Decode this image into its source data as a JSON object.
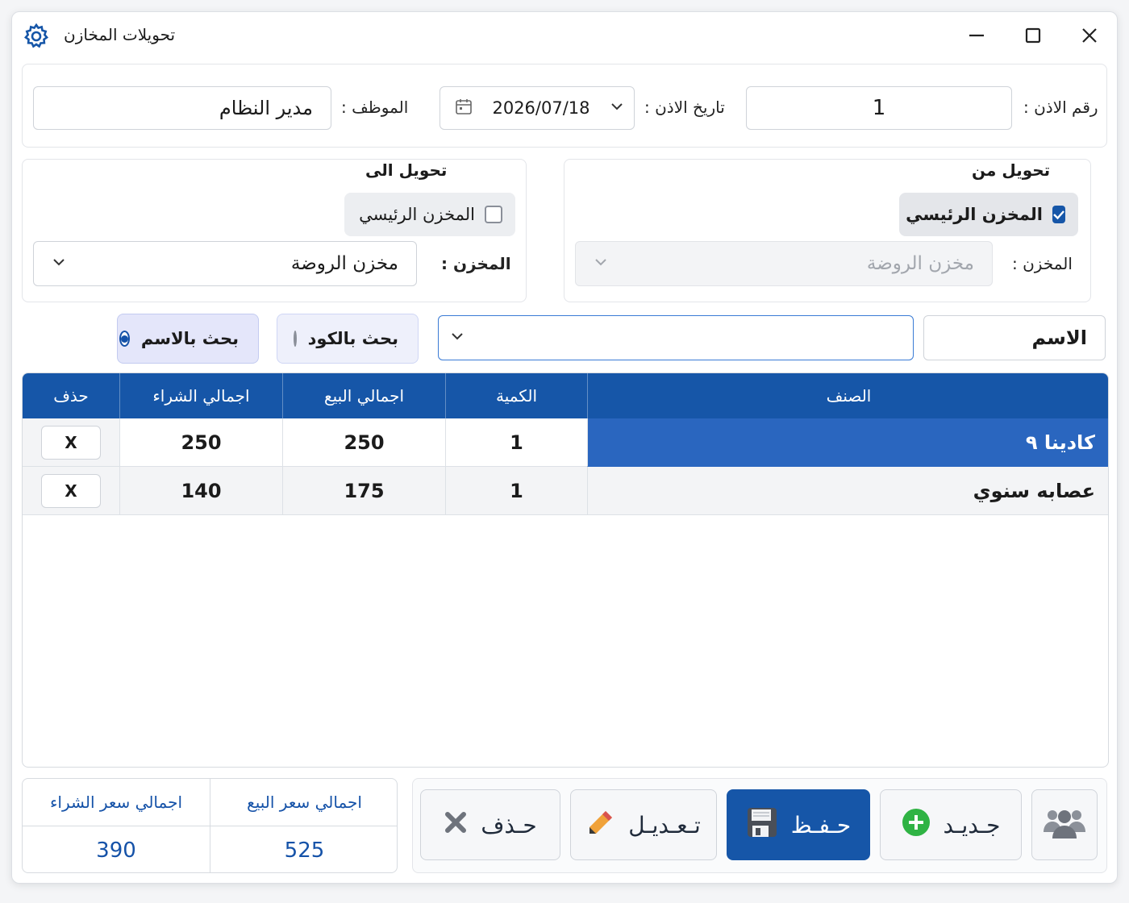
{
  "window": {
    "title": "تحويلات المخازن",
    "icon": "gear-icon",
    "controls": {
      "minimize": "minimize-icon",
      "maximize": "maximize-icon",
      "close": "close-icon"
    }
  },
  "header": {
    "permit_no_label": "رقم الاذن :",
    "permit_no_value": "1",
    "permit_date_label": "تاريخ الاذن :",
    "permit_date_value": "2026/07/18",
    "employee_label": "الموظف :",
    "employee_value": "مدير النظام"
  },
  "transfer_from": {
    "title": "تحويل من",
    "main_store_label": "المخزن الرئيسي",
    "main_store_checked": true,
    "store_label": "المخزن :",
    "store_value": "مخزن الروضة",
    "store_disabled": true
  },
  "transfer_to": {
    "title": "تحويل الى",
    "main_store_label": "المخزن الرئيسي",
    "main_store_checked": false,
    "store_label": "المخزن :",
    "store_value": "مخزن الروضة"
  },
  "search": {
    "name_field_value": "الاسم",
    "combo_value": "",
    "by_code_label": "بحث بالكود",
    "by_name_label": "بحث بالاسم",
    "selected_mode": "by_name"
  },
  "grid": {
    "columns": [
      "الصنف",
      "الكمية",
      "اجمالي البيع",
      "اجمالي الشراء",
      "حذف"
    ],
    "rows": [
      {
        "item": "كادينا ٩",
        "qty": "1",
        "sale_total": "250",
        "purchase_total": "250",
        "delete_label": "X",
        "selected": true
      },
      {
        "item": "عصابه سنوي",
        "qty": "1",
        "sale_total": "175",
        "purchase_total": "140",
        "delete_label": "X",
        "selected": false
      }
    ]
  },
  "totals": {
    "sale_label": "اجمالي سعر البيع",
    "sale_value": "525",
    "purchase_label": "اجمالي سعر الشراء",
    "purchase_value": "390"
  },
  "actions": {
    "users": "users-icon",
    "new_label": "جـديـد",
    "save_label": "حـفـظ",
    "edit_label": "تـعـديـل",
    "delete_label": "حـذف"
  },
  "colors": {
    "accent": "#1656a8",
    "selected_row": "#2a66bf",
    "new_icon": "#2fb344",
    "radio_bg": "#eef0fb"
  }
}
